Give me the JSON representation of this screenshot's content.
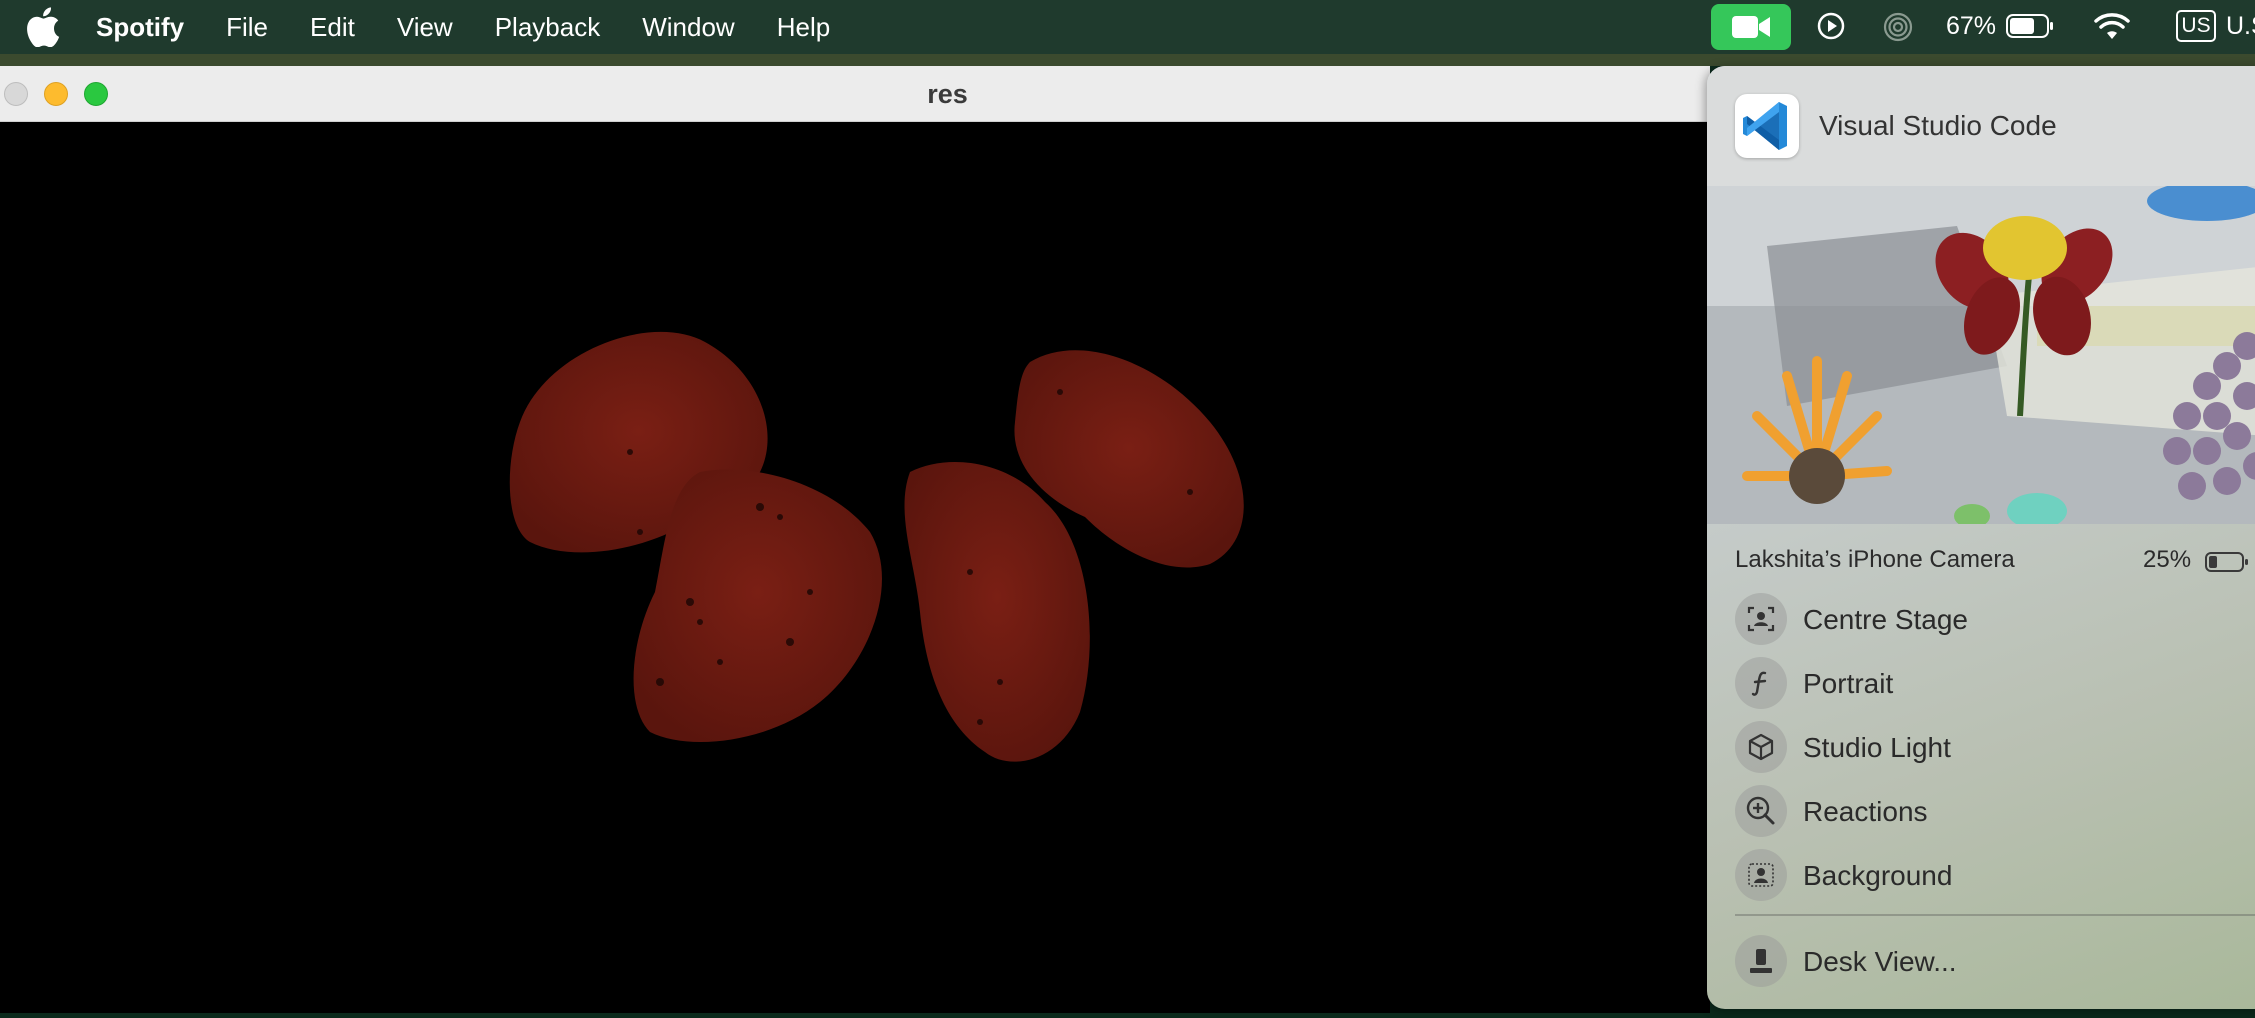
{
  "menubar": {
    "app_name": "Spotify",
    "menus": [
      "File",
      "Edit",
      "View",
      "Playback",
      "Window",
      "Help"
    ],
    "battery_percent": "67%",
    "input_source_badge": "US",
    "input_source_text": "U.S"
  },
  "window": {
    "title": "res"
  },
  "control_panel": {
    "app_name": "Visual Studio Code",
    "camera_name": "Lakshita’s iPhone Camera",
    "camera_battery": "25%",
    "options": [
      {
        "label": "Centre Stage",
        "icon": "centre-stage-icon"
      },
      {
        "label": "Portrait",
        "icon": "portrait-f-icon"
      },
      {
        "label": "Studio Light",
        "icon": "studio-light-cube-icon"
      },
      {
        "label": "Reactions",
        "icon": "reactions-icon"
      },
      {
        "label": "Background",
        "icon": "background-person-icon"
      }
    ],
    "desk_view_label": "Desk View...",
    "colors": {
      "camera_active_green": "#35c75a",
      "vscode_blue": "#1f8ad2"
    }
  }
}
